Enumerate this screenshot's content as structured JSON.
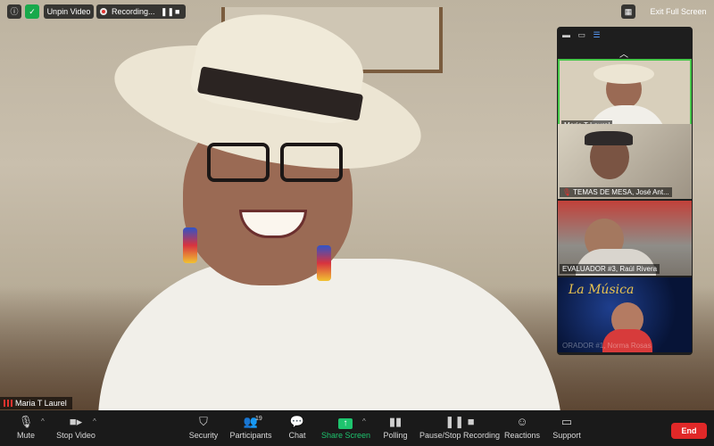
{
  "top_bar": {
    "info_icon": "info-icon",
    "shield_icon": "shield-icon",
    "unpin_label": "Unpin Video",
    "recording_label": "Recording...",
    "exit_fullscreen_label": "Exit Full Screen"
  },
  "main_video": {
    "participant_name": "Maria T Laurel"
  },
  "gallery": {
    "participants": [
      {
        "name": "Maria T Laurel",
        "muted": false,
        "active": true
      },
      {
        "name": "TEMAS DE MESA, José Ant...",
        "muted": true,
        "active": false
      },
      {
        "name": "EVALUADOR #3, Raúl Rivera",
        "muted": false,
        "active": false
      },
      {
        "name": "ORADOR #1, Norma Rosas",
        "muted": false,
        "active": false,
        "overlay_text": "La Música"
      }
    ]
  },
  "toolbar": {
    "items": [
      {
        "label": "Mute",
        "icon": "microphone-icon"
      },
      {
        "label": "Stop Video",
        "icon": "video-camera-icon"
      },
      {
        "label": "Security",
        "icon": "shield-icon"
      },
      {
        "label": "Participants",
        "icon": "participants-icon",
        "count": "19"
      },
      {
        "label": "Chat",
        "icon": "chat-icon"
      },
      {
        "label": "Share Screen",
        "icon": "share-screen-icon"
      },
      {
        "label": "Polling",
        "icon": "polling-icon"
      },
      {
        "label": "Pause/Stop Recording",
        "icon": "pause-stop-recording-icon"
      },
      {
        "label": "Reactions",
        "icon": "reactions-icon"
      },
      {
        "label": "Support",
        "icon": "support-icon"
      }
    ],
    "end_label": "End"
  },
  "colors": {
    "toolbar_bg": "#1a1a1a",
    "share_green": "#1ec46e",
    "end_red": "#e02828",
    "active_speaker_border": "#47c84a"
  }
}
